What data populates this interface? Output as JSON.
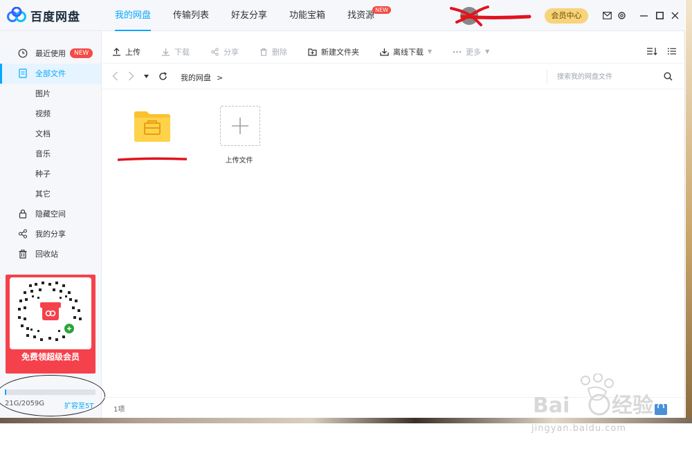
{
  "app": {
    "name": "百度网盘"
  },
  "nav": {
    "items": [
      {
        "label": "我的网盘"
      },
      {
        "label": "传输列表"
      },
      {
        "label": "好友分享"
      },
      {
        "label": "功能宝箱"
      },
      {
        "label": "找资源",
        "badge": "NEW"
      }
    ],
    "active_index": 0
  },
  "user": {
    "vip_button": "会员中心"
  },
  "sidebar": {
    "items": [
      {
        "label": "最近使用",
        "badge": "NEW"
      },
      {
        "label": "全部文件"
      },
      {
        "label": "图片"
      },
      {
        "label": "视频"
      },
      {
        "label": "文档"
      },
      {
        "label": "音乐"
      },
      {
        "label": "种子"
      },
      {
        "label": "其它"
      },
      {
        "label": "隐藏空间"
      },
      {
        "label": "我的分享"
      },
      {
        "label": "回收站"
      }
    ],
    "active_index": 1,
    "promo_text": "免费领超级会员"
  },
  "storage": {
    "used_label": "21G/2059G",
    "used_fraction": 0.0102,
    "expand_link": "扩容至5T"
  },
  "toolbar": {
    "upload": "上传",
    "download": "下载",
    "share": "分享",
    "delete": "删除",
    "new_folder": "新建文件夹",
    "offline_download": "离线下载",
    "more": "更多"
  },
  "path": {
    "current": "我的网盘",
    "separator": ">"
  },
  "search": {
    "placeholder": "搜索我的网盘文件"
  },
  "files": {
    "upload_label": "上传文件"
  },
  "status": {
    "count": "1项"
  },
  "watermark": {
    "text": "jingyan.baidu.com"
  },
  "colors": {
    "accent": "#06a7ff",
    "badge": "#f54a45",
    "vip": "#f7d37a",
    "folder": "#f9c22e",
    "promo": "#f5414b"
  }
}
